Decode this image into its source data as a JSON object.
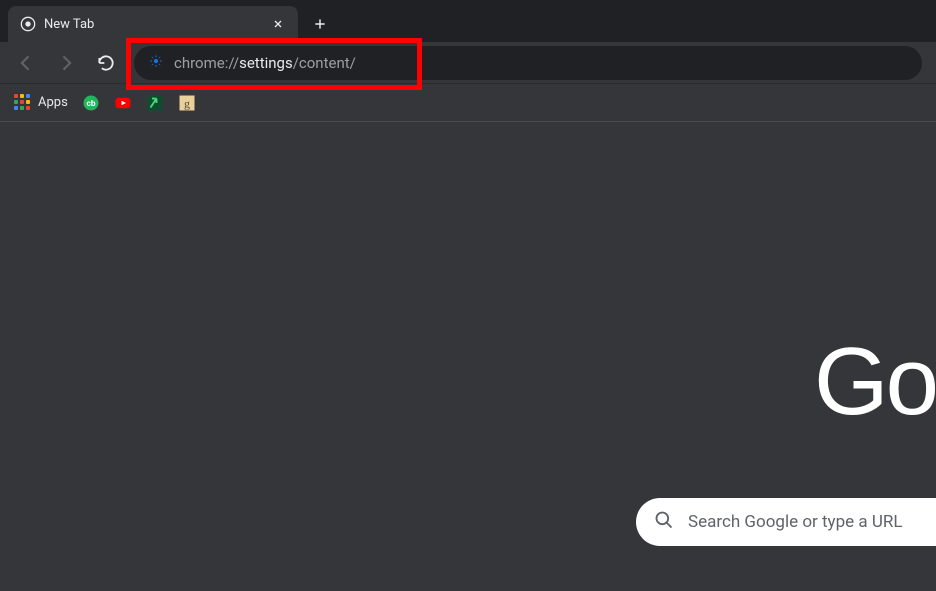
{
  "tab": {
    "title": "New Tab"
  },
  "omnibox": {
    "prefix": "chrome://",
    "bold": "settings",
    "suffix": "/content/"
  },
  "bookmarks": {
    "apps_label": "Apps"
  },
  "content": {
    "logo_text": "Go",
    "search_placeholder": "Search Google or type a URL"
  }
}
